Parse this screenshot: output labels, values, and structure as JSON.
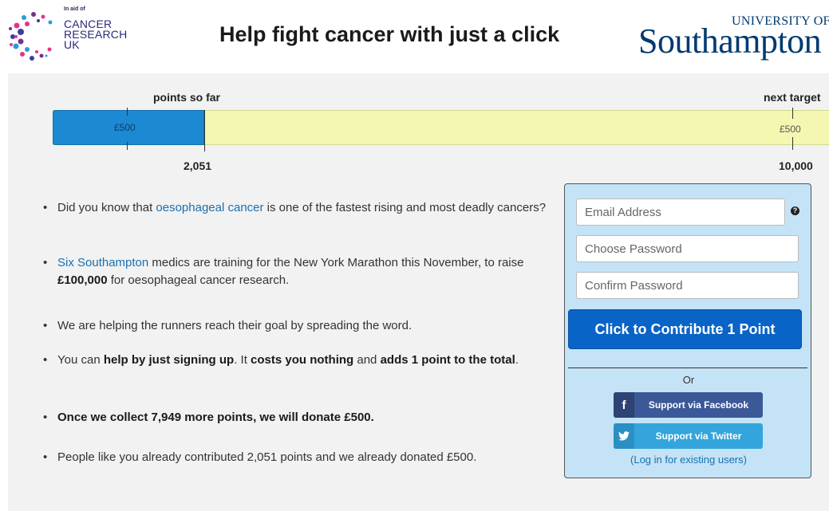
{
  "header": {
    "cr_in_aid": "In aid of",
    "cr_line1": "CANCER",
    "cr_line2": "RESEARCH",
    "cr_line3": "UK",
    "headline": "Help fight cancer with just a click",
    "uni_top": "UNIVERSITY OF",
    "uni_main": "Southampton"
  },
  "progress": {
    "label_so_far": "points so far",
    "label_next": "next target",
    "current_points": "2,051",
    "target_points": "10,000",
    "fill_fraction": 0.2051,
    "donated_tick_label": "£500",
    "target_tick_label": "£500",
    "colors": {
      "fill": "#1c8ad3",
      "remaining": "#f4f7b0"
    }
  },
  "bullets": {
    "b1_pre": "Did you know that ",
    "b1_link": "oesophageal cancer",
    "b1_post": " is one of the fastest rising and most deadly cancers?",
    "b2_link": "Six Southampton",
    "b2_mid": " medics are training for the New York Marathon this November, to raise ",
    "b2_bold": "£100,000",
    "b2_post": " for oesophageal cancer research.",
    "b3": "We are helping the runners reach their goal by spreading the word.",
    "b4_pre": "You can ",
    "b4_bold1": "help by just signing up",
    "b4_mid1": ". It ",
    "b4_bold2": "costs you nothing",
    "b4_mid2": " and ",
    "b4_bold3": "adds 1 point to the total",
    "b4_post": ".",
    "b5": "Once we collect 7,949 more points, we will donate £500.",
    "b6": "People like you already contributed 2,051 points and we already donated £500."
  },
  "signup": {
    "email_placeholder": "Email Address",
    "password_placeholder": "Choose Password",
    "confirm_placeholder": "Confirm Password",
    "help_icon_glyph": "?",
    "cta_label": "Click to Contribute 1 Point",
    "or_label": "Or",
    "facebook_glyph": "f",
    "facebook_label": "Support via Facebook",
    "twitter_glyph": "🐦",
    "twitter_label": "Support via Twitter",
    "login_link": "(Log in for existing users)",
    "colors": {
      "cta": "#0a63c7",
      "facebook": "#3b5998",
      "twitter": "#33a5dc",
      "box": "#c4e3f6"
    }
  }
}
